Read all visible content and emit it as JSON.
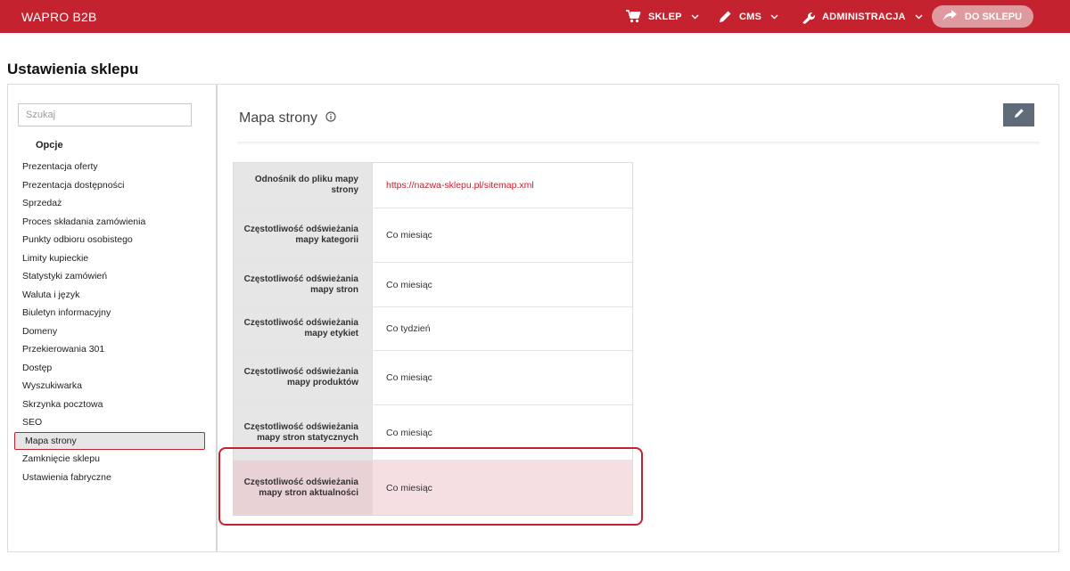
{
  "topbar": {
    "brand": "WAPRO B2B",
    "nav": [
      {
        "label": "SKLEP",
        "icon": "cart-icon"
      },
      {
        "label": "CMS",
        "icon": "pencil-icon"
      },
      {
        "label": "ADMINISTRACJA",
        "icon": "wrench-icon"
      }
    ],
    "to_shop_label": "DO SKLEPU",
    "bar_color": "#c4222e"
  },
  "page": {
    "title": "Ustawienia sklepu"
  },
  "sidebar": {
    "search_placeholder": "Szukaj",
    "section_label": "Opcje",
    "items": [
      "Prezentacja oferty",
      "Prezentacja dostępności",
      "Sprzedaż",
      "Proces składania zamówienia",
      "Punkty odbioru osobistego",
      "Limity kupieckie",
      "Statystyki zamówień",
      "Waluta i język",
      "Biuletyn informacyjny",
      "Domeny",
      "Przekierowania 301",
      "Dostęp",
      "Wyszukiwarka",
      "Skrzynka pocztowa",
      "SEO",
      "Mapa strony",
      "Zamknięcie sklepu",
      "Ustawienia fabryczne"
    ],
    "active_item": "Mapa strony"
  },
  "content": {
    "title": "Mapa strony",
    "rows": [
      {
        "key": "Odnośnik do pliku mapy strony",
        "value": "https://nazwa-sklepu.pl/sitemap.xml"
      },
      {
        "key": "Częstotliwość odświeżania mapy kategorii",
        "value": "Co miesiąc"
      },
      {
        "key": "Częstotliwość odświeżania mapy stron",
        "value": "Co miesiąc"
      },
      {
        "key": "Częstotliwość odświeżania mapy etykiet",
        "value": "Co tydzień"
      },
      {
        "key": "Częstotliwość odświeżania mapy produktów",
        "value": "Co miesiąc"
      },
      {
        "key": "Częstotliwość odświeżania mapy stron statycznych",
        "value": "Co miesiąc"
      },
      {
        "key": "Częstotliwość odświeżania mapy stron aktualności",
        "value": "Co miesiąc"
      }
    ]
  }
}
